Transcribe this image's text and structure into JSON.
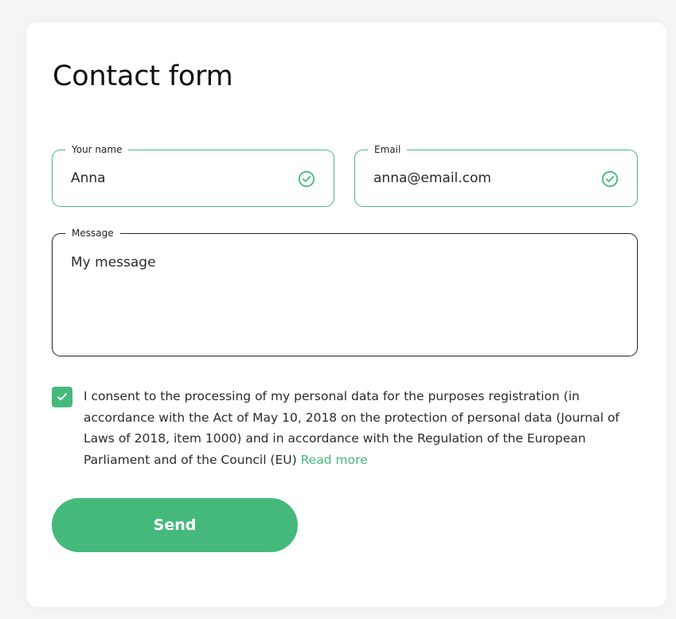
{
  "form": {
    "title": "Contact form",
    "name_field": {
      "label": "Your name",
      "value": "Anna",
      "status_icon": "check-circle-icon"
    },
    "email_field": {
      "label": "Email",
      "value": "anna@email.com",
      "status_icon": "check-circle-icon"
    },
    "message_field": {
      "label": "Message",
      "value": "My message"
    },
    "consent": {
      "checked": true,
      "text": "I consent to the processing of my personal data for the purposes registration (in accordance with the Act of May 10, 2018 on the protection of personal data (Journal of Laws of 2018, item 1000) and in accordance with the Regulation of the European Parliament and of the Council (EU)",
      "read_more_label": "Read more"
    },
    "send_label": "Send"
  },
  "colors": {
    "accent": "#45b97c",
    "text": "#222222",
    "background": "#f4f4f4",
    "card": "#ffffff"
  }
}
